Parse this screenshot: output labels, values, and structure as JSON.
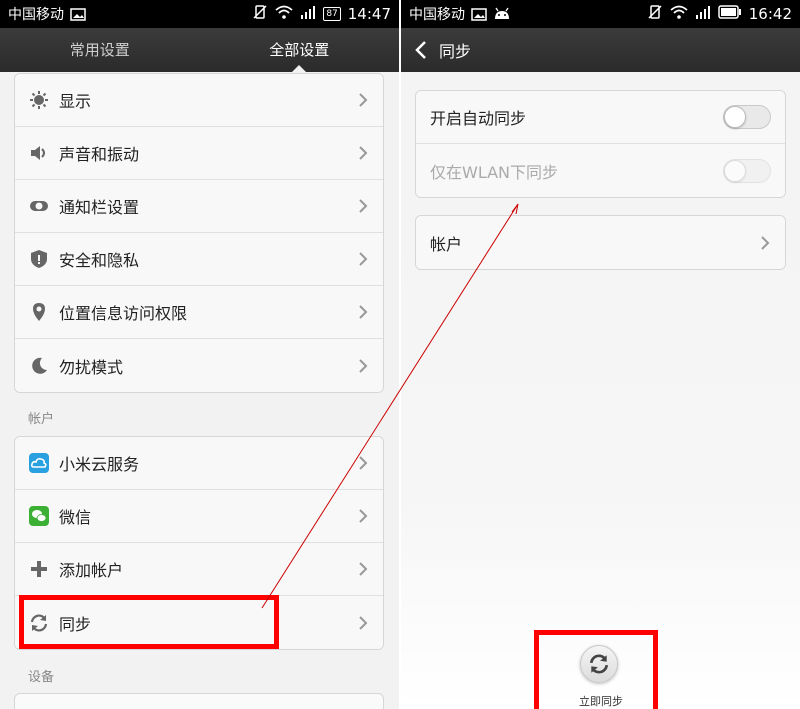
{
  "left": {
    "status": {
      "carrier": "中国移动",
      "battery": "87",
      "time": "14:47"
    },
    "tabs": [
      {
        "label": "常用设置"
      },
      {
        "label": "全部设置"
      }
    ],
    "groups": [
      {
        "items": [
          {
            "label": "显示",
            "icon": "brightness-icon"
          },
          {
            "label": "声音和振动",
            "icon": "speaker-icon"
          },
          {
            "label": "通知栏设置",
            "icon": "toggle-icon"
          },
          {
            "label": "安全和隐私",
            "icon": "shield-icon"
          },
          {
            "label": "位置信息访问权限",
            "icon": "location-pin-icon"
          },
          {
            "label": "勿扰模式",
            "icon": "moon-icon"
          }
        ]
      },
      {
        "items": [
          {
            "label": "小米云服务",
            "icon": "cloud-icon"
          },
          {
            "label": "微信",
            "icon": "wechat-icon"
          },
          {
            "label": "添加帐户",
            "icon": "plus-icon"
          },
          {
            "label": "同步",
            "icon": "sync-icon"
          }
        ]
      }
    ],
    "section_labels": {
      "account": "帐户",
      "device": "设备"
    }
  },
  "right": {
    "status": {
      "carrier": "中国移动",
      "time": "16:42"
    },
    "title": "同步",
    "toggles": [
      {
        "label": "开启自动同步",
        "enabled": true,
        "on": false
      },
      {
        "label": "仅在WLAN下同步",
        "enabled": false,
        "on": false
      }
    ],
    "account_row": {
      "label": "帐户"
    },
    "sync_now": {
      "label": "立即同步"
    }
  },
  "colors": {
    "highlight": "#ff0000",
    "bar": "#2b2b2b",
    "annotation_arrow": "#cc0000"
  }
}
